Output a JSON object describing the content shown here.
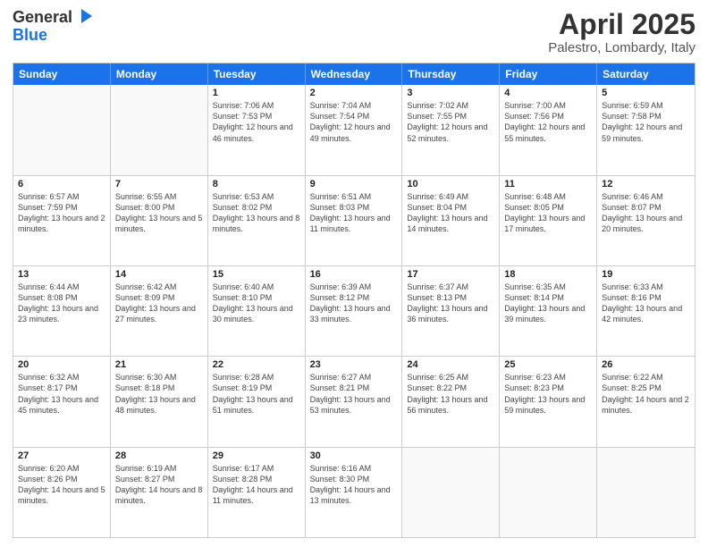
{
  "header": {
    "logo_line1": "General",
    "logo_line2": "Blue",
    "title": "April 2025",
    "subtitle": "Palestro, Lombardy, Italy"
  },
  "weekdays": [
    "Sunday",
    "Monday",
    "Tuesday",
    "Wednesday",
    "Thursday",
    "Friday",
    "Saturday"
  ],
  "rows": [
    [
      {
        "day": "",
        "info": ""
      },
      {
        "day": "",
        "info": ""
      },
      {
        "day": "1",
        "info": "Sunrise: 7:06 AM\nSunset: 7:53 PM\nDaylight: 12 hours and 46 minutes."
      },
      {
        "day": "2",
        "info": "Sunrise: 7:04 AM\nSunset: 7:54 PM\nDaylight: 12 hours and 49 minutes."
      },
      {
        "day": "3",
        "info": "Sunrise: 7:02 AM\nSunset: 7:55 PM\nDaylight: 12 hours and 52 minutes."
      },
      {
        "day": "4",
        "info": "Sunrise: 7:00 AM\nSunset: 7:56 PM\nDaylight: 12 hours and 55 minutes."
      },
      {
        "day": "5",
        "info": "Sunrise: 6:59 AM\nSunset: 7:58 PM\nDaylight: 12 hours and 59 minutes."
      }
    ],
    [
      {
        "day": "6",
        "info": "Sunrise: 6:57 AM\nSunset: 7:59 PM\nDaylight: 13 hours and 2 minutes."
      },
      {
        "day": "7",
        "info": "Sunrise: 6:55 AM\nSunset: 8:00 PM\nDaylight: 13 hours and 5 minutes."
      },
      {
        "day": "8",
        "info": "Sunrise: 6:53 AM\nSunset: 8:02 PM\nDaylight: 13 hours and 8 minutes."
      },
      {
        "day": "9",
        "info": "Sunrise: 6:51 AM\nSunset: 8:03 PM\nDaylight: 13 hours and 11 minutes."
      },
      {
        "day": "10",
        "info": "Sunrise: 6:49 AM\nSunset: 8:04 PM\nDaylight: 13 hours and 14 minutes."
      },
      {
        "day": "11",
        "info": "Sunrise: 6:48 AM\nSunset: 8:05 PM\nDaylight: 13 hours and 17 minutes."
      },
      {
        "day": "12",
        "info": "Sunrise: 6:46 AM\nSunset: 8:07 PM\nDaylight: 13 hours and 20 minutes."
      }
    ],
    [
      {
        "day": "13",
        "info": "Sunrise: 6:44 AM\nSunset: 8:08 PM\nDaylight: 13 hours and 23 minutes."
      },
      {
        "day": "14",
        "info": "Sunrise: 6:42 AM\nSunset: 8:09 PM\nDaylight: 13 hours and 27 minutes."
      },
      {
        "day": "15",
        "info": "Sunrise: 6:40 AM\nSunset: 8:10 PM\nDaylight: 13 hours and 30 minutes."
      },
      {
        "day": "16",
        "info": "Sunrise: 6:39 AM\nSunset: 8:12 PM\nDaylight: 13 hours and 33 minutes."
      },
      {
        "day": "17",
        "info": "Sunrise: 6:37 AM\nSunset: 8:13 PM\nDaylight: 13 hours and 36 minutes."
      },
      {
        "day": "18",
        "info": "Sunrise: 6:35 AM\nSunset: 8:14 PM\nDaylight: 13 hours and 39 minutes."
      },
      {
        "day": "19",
        "info": "Sunrise: 6:33 AM\nSunset: 8:16 PM\nDaylight: 13 hours and 42 minutes."
      }
    ],
    [
      {
        "day": "20",
        "info": "Sunrise: 6:32 AM\nSunset: 8:17 PM\nDaylight: 13 hours and 45 minutes."
      },
      {
        "day": "21",
        "info": "Sunrise: 6:30 AM\nSunset: 8:18 PM\nDaylight: 13 hours and 48 minutes."
      },
      {
        "day": "22",
        "info": "Sunrise: 6:28 AM\nSunset: 8:19 PM\nDaylight: 13 hours and 51 minutes."
      },
      {
        "day": "23",
        "info": "Sunrise: 6:27 AM\nSunset: 8:21 PM\nDaylight: 13 hours and 53 minutes."
      },
      {
        "day": "24",
        "info": "Sunrise: 6:25 AM\nSunset: 8:22 PM\nDaylight: 13 hours and 56 minutes."
      },
      {
        "day": "25",
        "info": "Sunrise: 6:23 AM\nSunset: 8:23 PM\nDaylight: 13 hours and 59 minutes."
      },
      {
        "day": "26",
        "info": "Sunrise: 6:22 AM\nSunset: 8:25 PM\nDaylight: 14 hours and 2 minutes."
      }
    ],
    [
      {
        "day": "27",
        "info": "Sunrise: 6:20 AM\nSunset: 8:26 PM\nDaylight: 14 hours and 5 minutes."
      },
      {
        "day": "28",
        "info": "Sunrise: 6:19 AM\nSunset: 8:27 PM\nDaylight: 14 hours and 8 minutes."
      },
      {
        "day": "29",
        "info": "Sunrise: 6:17 AM\nSunset: 8:28 PM\nDaylight: 14 hours and 11 minutes."
      },
      {
        "day": "30",
        "info": "Sunrise: 6:16 AM\nSunset: 8:30 PM\nDaylight: 14 hours and 13 minutes."
      },
      {
        "day": "",
        "info": ""
      },
      {
        "day": "",
        "info": ""
      },
      {
        "day": "",
        "info": ""
      }
    ]
  ]
}
